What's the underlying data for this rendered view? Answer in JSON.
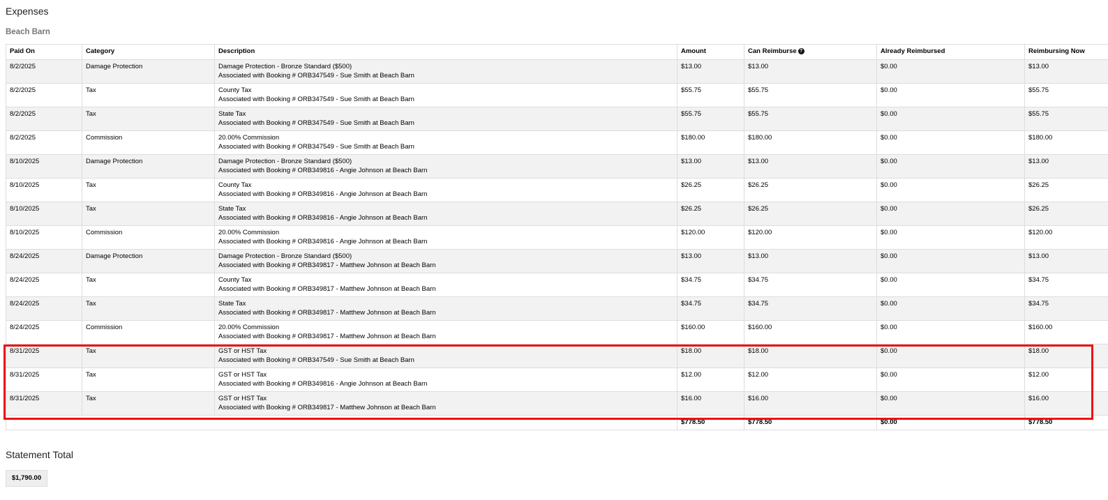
{
  "section_title": "Expenses",
  "property_name": "Beach Barn",
  "help_icon_glyph": "?",
  "highlight_color": "#ee1111",
  "table": {
    "headers": {
      "paid_on": "Paid On",
      "category": "Category",
      "description": "Description",
      "amount": "Amount",
      "can_reimburse": "Can Reimburse",
      "already_reimbursed": "Already Reimbursed",
      "reimbursing_now": "Reimbursing Now"
    },
    "rows": [
      {
        "paid_on": "8/2/2025",
        "category": "Damage Protection",
        "desc1": "Damage Protection - Bronze Standard ($500)",
        "desc2": "Associated with Booking # ORB347549 - Sue Smith at Beach Barn",
        "amount": "$13.00",
        "can_reimburse": "$13.00",
        "already_reimbursed": "$0.00",
        "reimbursing_now": "$13.00"
      },
      {
        "paid_on": "8/2/2025",
        "category": "Tax",
        "desc1": "County Tax",
        "desc2": "Associated with Booking # ORB347549 - Sue Smith at Beach Barn",
        "amount": "$55.75",
        "can_reimburse": "$55.75",
        "already_reimbursed": "$0.00",
        "reimbursing_now": "$55.75"
      },
      {
        "paid_on": "8/2/2025",
        "category": "Tax",
        "desc1": "State Tax",
        "desc2": "Associated with Booking # ORB347549 - Sue Smith at Beach Barn",
        "amount": "$55.75",
        "can_reimburse": "$55.75",
        "already_reimbursed": "$0.00",
        "reimbursing_now": "$55.75"
      },
      {
        "paid_on": "8/2/2025",
        "category": "Commission",
        "desc1": "20.00% Commission",
        "desc2": "Associated with Booking # ORB347549 - Sue Smith at Beach Barn",
        "amount": "$180.00",
        "can_reimburse": "$180.00",
        "already_reimbursed": "$0.00",
        "reimbursing_now": "$180.00"
      },
      {
        "paid_on": "8/10/2025",
        "category": "Damage Protection",
        "desc1": "Damage Protection - Bronze Standard ($500)",
        "desc2": "Associated with Booking # ORB349816 - Angie Johnson at Beach Barn",
        "amount": "$13.00",
        "can_reimburse": "$13.00",
        "already_reimbursed": "$0.00",
        "reimbursing_now": "$13.00"
      },
      {
        "paid_on": "8/10/2025",
        "category": "Tax",
        "desc1": "County Tax",
        "desc2": "Associated with Booking # ORB349816 - Angie Johnson at Beach Barn",
        "amount": "$26.25",
        "can_reimburse": "$26.25",
        "already_reimbursed": "$0.00",
        "reimbursing_now": "$26.25"
      },
      {
        "paid_on": "8/10/2025",
        "category": "Tax",
        "desc1": "State Tax",
        "desc2": "Associated with Booking # ORB349816 - Angie Johnson at Beach Barn",
        "amount": "$26.25",
        "can_reimburse": "$26.25",
        "already_reimbursed": "$0.00",
        "reimbursing_now": "$26.25"
      },
      {
        "paid_on": "8/10/2025",
        "category": "Commission",
        "desc1": "20.00% Commission",
        "desc2": "Associated with Booking # ORB349816 - Angie Johnson at Beach Barn",
        "amount": "$120.00",
        "can_reimburse": "$120.00",
        "already_reimbursed": "$0.00",
        "reimbursing_now": "$120.00"
      },
      {
        "paid_on": "8/24/2025",
        "category": "Damage Protection",
        "desc1": "Damage Protection - Bronze Standard ($500)",
        "desc2": "Associated with Booking # ORB349817 - Matthew Johnson at Beach Barn",
        "amount": "$13.00",
        "can_reimburse": "$13.00",
        "already_reimbursed": "$0.00",
        "reimbursing_now": "$13.00"
      },
      {
        "paid_on": "8/24/2025",
        "category": "Tax",
        "desc1": "County Tax",
        "desc2": "Associated with Booking # ORB349817 - Matthew Johnson at Beach Barn",
        "amount": "$34.75",
        "can_reimburse": "$34.75",
        "already_reimbursed": "$0.00",
        "reimbursing_now": "$34.75"
      },
      {
        "paid_on": "8/24/2025",
        "category": "Tax",
        "desc1": "State Tax",
        "desc2": "Associated with Booking # ORB349817 - Matthew Johnson at Beach Barn",
        "amount": "$34.75",
        "can_reimburse": "$34.75",
        "already_reimbursed": "$0.00",
        "reimbursing_now": "$34.75"
      },
      {
        "paid_on": "8/24/2025",
        "category": "Commission",
        "desc1": "20.00% Commission",
        "desc2": "Associated with Booking # ORB349817 - Matthew Johnson at Beach Barn",
        "amount": "$160.00",
        "can_reimburse": "$160.00",
        "already_reimbursed": "$0.00",
        "reimbursing_now": "$160.00"
      },
      {
        "paid_on": "8/31/2025",
        "category": "Tax",
        "desc1": "GST or HST Tax",
        "desc2": "Associated with Booking # ORB347549 - Sue Smith at Beach Barn",
        "amount": "$18.00",
        "can_reimburse": "$18.00",
        "already_reimbursed": "$0.00",
        "reimbursing_now": "$18.00"
      },
      {
        "paid_on": "8/31/2025",
        "category": "Tax",
        "desc1": "GST or HST Tax",
        "desc2": "Associated with Booking # ORB349816 - Angie Johnson at Beach Barn",
        "amount": "$12.00",
        "can_reimburse": "$12.00",
        "already_reimbursed": "$0.00",
        "reimbursing_now": "$12.00"
      },
      {
        "paid_on": "8/31/2025",
        "category": "Tax",
        "desc1": "GST or HST Tax",
        "desc2": "Associated with Booking # ORB349817 - Matthew Johnson at Beach Barn",
        "amount": "$16.00",
        "can_reimburse": "$16.00",
        "already_reimbursed": "$0.00",
        "reimbursing_now": "$16.00"
      }
    ],
    "totals": {
      "amount": "$778.50",
      "can_reimburse": "$778.50",
      "already_reimbursed": "$0.00",
      "reimbursing_now": "$778.50"
    }
  },
  "statement": {
    "title": "Statement Total",
    "total": "$1,790.00"
  }
}
